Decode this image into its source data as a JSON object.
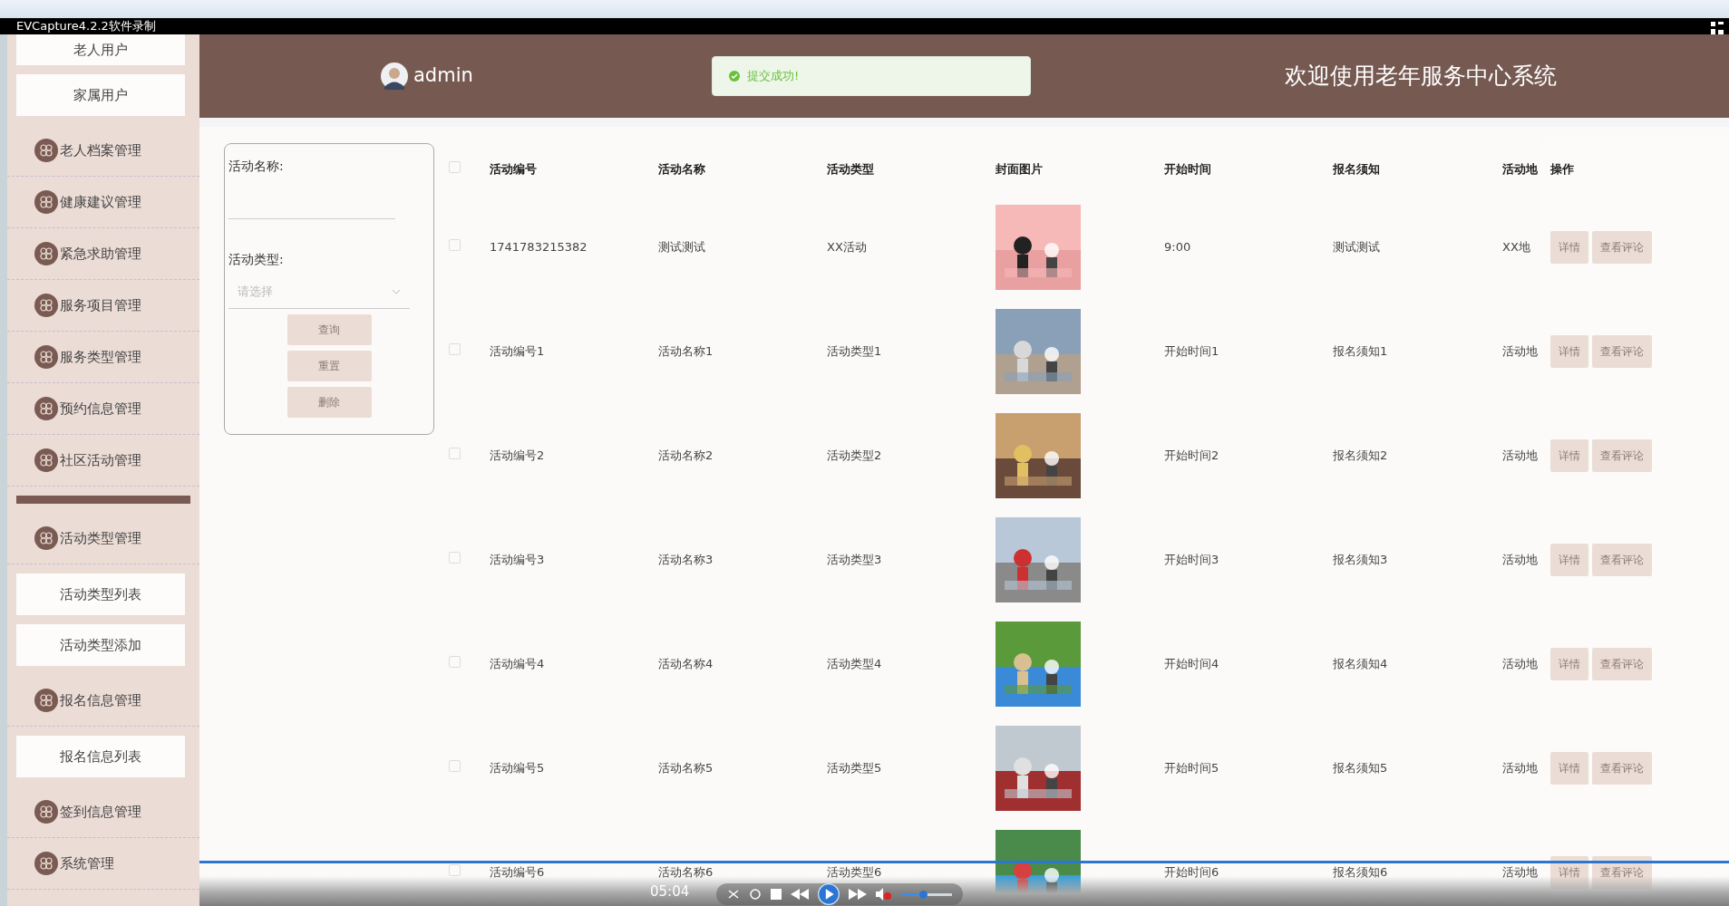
{
  "recorder": {
    "title": "EVCapture4.2.2软件录制"
  },
  "sidebar": {
    "items": [
      {
        "kind": "sub",
        "label": "老人用户"
      },
      {
        "kind": "sub",
        "label": "家属用户"
      },
      {
        "kind": "menu",
        "label": "老人档案管理"
      },
      {
        "kind": "menu",
        "label": "健康建议管理"
      },
      {
        "kind": "menu",
        "label": "紧急求助管理"
      },
      {
        "kind": "menu",
        "label": "服务项目管理"
      },
      {
        "kind": "menu",
        "label": "服务类型管理"
      },
      {
        "kind": "menu",
        "label": "预约信息管理"
      },
      {
        "kind": "menu",
        "label": "社区活动管理"
      },
      {
        "kind": "bar"
      },
      {
        "kind": "menu",
        "label": "活动类型管理"
      },
      {
        "kind": "sub",
        "label": "活动类型列表"
      },
      {
        "kind": "sub",
        "label": "活动类型添加"
      },
      {
        "kind": "menu",
        "label": "报名信息管理"
      },
      {
        "kind": "sub",
        "label": "报名信息列表"
      },
      {
        "kind": "menu",
        "label": "签到信息管理"
      },
      {
        "kind": "menu",
        "label": "系统管理"
      }
    ]
  },
  "header": {
    "user": "admin",
    "toast": "提交成功!",
    "title": "欢迎使用老年服务中心系统"
  },
  "filter": {
    "fields": [
      {
        "kind": "text",
        "label": "活动名称:"
      },
      {
        "kind": "select",
        "label": "活动类型:",
        "placeholder": "请选择"
      }
    ],
    "buttons": [
      "查询",
      "重置",
      "删除"
    ]
  },
  "table": {
    "all_checked": false,
    "columns": [
      "活动编号",
      "活动名称",
      "活动类型",
      "封面图片",
      "开始时间",
      "报名须知",
      "活动地",
      "操作"
    ],
    "rows": [
      {
        "checked": false,
        "cells": [
          "1741783215382",
          "测试测试",
          "XX活动",
          {
            "kind": "picture"
          },
          "9:00",
          "测试测试",
          "XX地"
        ],
        "actions": [
          "详情",
          "查看评论"
        ]
      },
      {
        "checked": false,
        "cells": [
          "活动编号1",
          "活动名称1",
          "活动类型1",
          {
            "kind": "picture"
          },
          "开始时间1",
          "报名须知1",
          "活动地"
        ],
        "actions": [
          "详情",
          "查看评论"
        ]
      },
      {
        "checked": false,
        "cells": [
          "活动编号2",
          "活动名称2",
          "活动类型2",
          {
            "kind": "picture"
          },
          "开始时间2",
          "报名须知2",
          "活动地"
        ],
        "actions": [
          "详情",
          "查看评论"
        ]
      },
      {
        "checked": false,
        "cells": [
          "活动编号3",
          "活动名称3",
          "活动类型3",
          {
            "kind": "picture"
          },
          "开始时间3",
          "报名须知3",
          "活动地"
        ],
        "actions": [
          "详情",
          "查看评论"
        ]
      },
      {
        "checked": false,
        "cells": [
          "活动编号4",
          "活动名称4",
          "活动类型4",
          {
            "kind": "picture"
          },
          "开始时间4",
          "报名须知4",
          "活动地"
        ],
        "actions": [
          "详情",
          "查看评论"
        ]
      },
      {
        "checked": false,
        "cells": [
          "活动编号5",
          "活动名称5",
          "活动类型5",
          {
            "kind": "picture"
          },
          "开始时间5",
          "报名须知5",
          "活动地"
        ],
        "actions": [
          "详情",
          "查看评论"
        ]
      },
      {
        "checked": false,
        "cells": [
          "活动编号6",
          "活动名称6",
          "活动类型6",
          {
            "kind": "picture"
          },
          "开始时间6",
          "报名须知6",
          "活动地"
        ],
        "actions": [
          "详情",
          "查看评论"
        ]
      }
    ]
  },
  "player": {
    "time": "05:04"
  }
}
